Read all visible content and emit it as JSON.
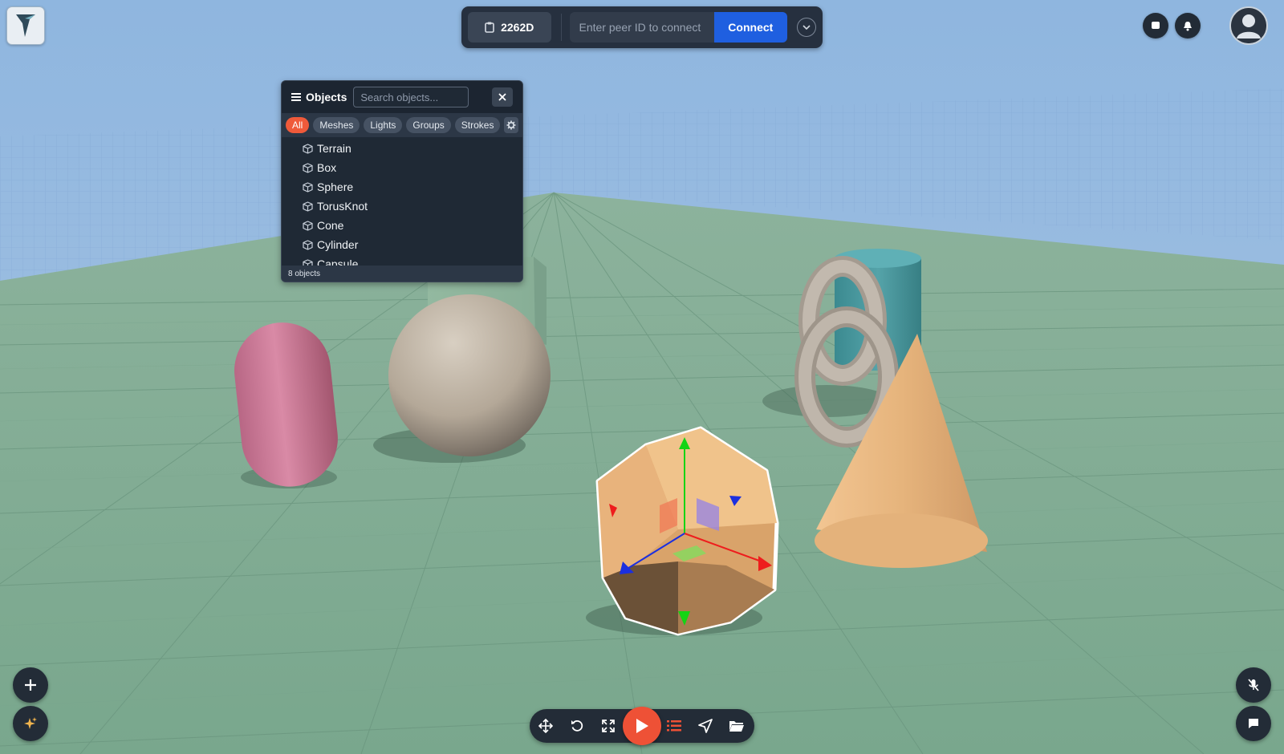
{
  "connect_bar": {
    "peer_id": "2262D",
    "peer_input_placeholder": "Enter peer ID to connect",
    "connect_label": "Connect"
  },
  "objects_panel": {
    "title": "Objects",
    "search_placeholder": "Search objects...",
    "filters": [
      "All",
      "Meshes",
      "Lights",
      "Groups",
      "Strokes"
    ],
    "active_filter": "All",
    "items": [
      "Terrain",
      "Box",
      "Sphere",
      "TorusKnot",
      "Cone",
      "Cylinder",
      "Capsule"
    ],
    "footer": "8 objects"
  },
  "scene": {
    "objects": [
      "Capsule",
      "Sphere",
      "Box",
      "TorusKnot",
      "Cylinder",
      "Cone",
      "Dodecahedron"
    ],
    "selected": "Dodecahedron",
    "colors": {
      "sky_top": "#8fb6df",
      "ground": "#7dab92",
      "capsule": "#d67f9c",
      "sphere": "#bfb3a3",
      "cone": "#e9b77e",
      "cylinder": "#4b9aa0",
      "torus": "#bab1a6",
      "selected_outline": "#ffffff"
    }
  },
  "icons": {
    "logo": "app-logo-icon",
    "peer": "clipboard-icon",
    "dropdown": "chevron-down-icon",
    "chat_top": "message-icon",
    "notifications": "bell-icon",
    "avatar": "user-avatar-icon",
    "menu": "hamburger-icon",
    "close": "close-icon",
    "filter_settings": "gear-icon",
    "object": "cube-icon",
    "add": "plus-icon",
    "ai": "sparkles-icon",
    "move": "move-icon",
    "rotate": "rotate-icon",
    "scale": "expand-icon",
    "play": "play-icon",
    "list": "list-icon",
    "navigate": "navigate-icon",
    "folder": "folder-icon",
    "mic": "mic-off-icon",
    "chat_bottom": "chat-icon"
  },
  "accent_colors": {
    "primary": "#1f5fe0",
    "play": "#ee5136",
    "active_chip": "#ef5a3a",
    "toolbar_bg": "#232c37"
  }
}
